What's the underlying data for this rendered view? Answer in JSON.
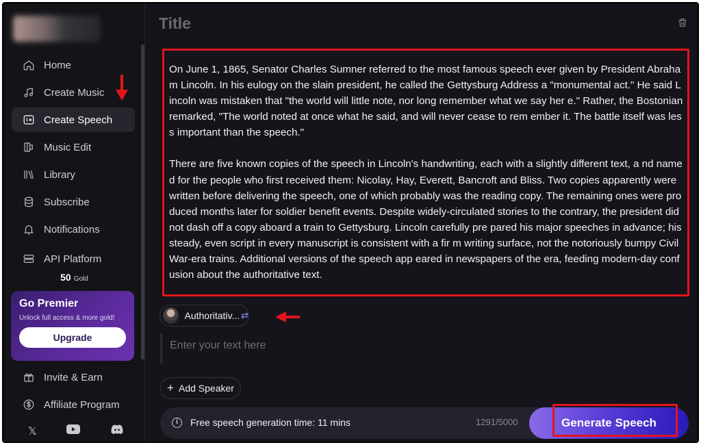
{
  "sidebar": {
    "nav": [
      {
        "label": "Home",
        "icon": "home-icon"
      },
      {
        "label": "Create Music",
        "icon": "music-note-icon"
      },
      {
        "label": "Create Speech",
        "icon": "speech-icon",
        "active": true
      },
      {
        "label": "Music Edit",
        "icon": "music-edit-icon"
      },
      {
        "label": "Library",
        "icon": "library-icon"
      },
      {
        "label": "Subscribe",
        "icon": "database-icon"
      },
      {
        "label": "Notifications",
        "icon": "bell-icon"
      }
    ],
    "api_platform": "API Platform",
    "gold_amount": "50",
    "gold_unit": "Gold",
    "premier": {
      "title": "Go Premier",
      "subtitle": "Unlock full access & more gold!",
      "button": "Upgrade"
    },
    "bottom_nav": [
      {
        "label": "Invite & Earn",
        "icon": "gift-icon"
      },
      {
        "label": "Affiliate Program",
        "icon": "dollar-circle-icon"
      }
    ],
    "socials": {
      "x": "𝕏",
      "youtube": "youtube-icon",
      "discord": "discord-icon"
    }
  },
  "main": {
    "title": "Title",
    "editor_paragraphs": [
      "On June 1, 1865, Senator Charles Sumner referred to the most famous speech ever given by President Abraham Lincoln. In his eulogy on the slain president, he called the Gettysburg Address a \"monumental act.\" He said Lincoln was mistaken that \"the world will little note, nor long remember what we say her e.\" Rather, the Bostonian remarked, \"The world noted at once what he said, and will never cease to rem ember it. The battle itself was less important than the speech.\"",
      "There are five known copies of the speech in Lincoln's handwriting, each with a slightly different text, a nd named for the people who first received them: Nicolay, Hay, Everett, Bancroft and Bliss. Two copies apparently were written before delivering the speech, one of which probably was the reading copy. The remaining ones were produced months later for soldier benefit events. Despite widely-circulated stories to the contrary, the president did not dash off a copy aboard a train to Gettysburg. Lincoln carefully pre pared his major speeches in advance; his steady, even script in every manuscript is consistent with a fir m writing surface, not the notoriously bumpy Civil War-era trains. Additional versions of the speech app eared in newspapers of the era, feeding modern-day confusion about the authoritative text."
    ],
    "speaker_label": "Authoritativ...",
    "text_placeholder": "Enter your text here",
    "add_speaker": "Add Speaker",
    "info_text": "Free speech generation time: 11 mins",
    "counter": "1291/5000",
    "generate_button": "Generate Speech"
  },
  "colors": {
    "background": "#14141a",
    "highlight": "#e4141e",
    "accent": "#5b3ed8"
  }
}
